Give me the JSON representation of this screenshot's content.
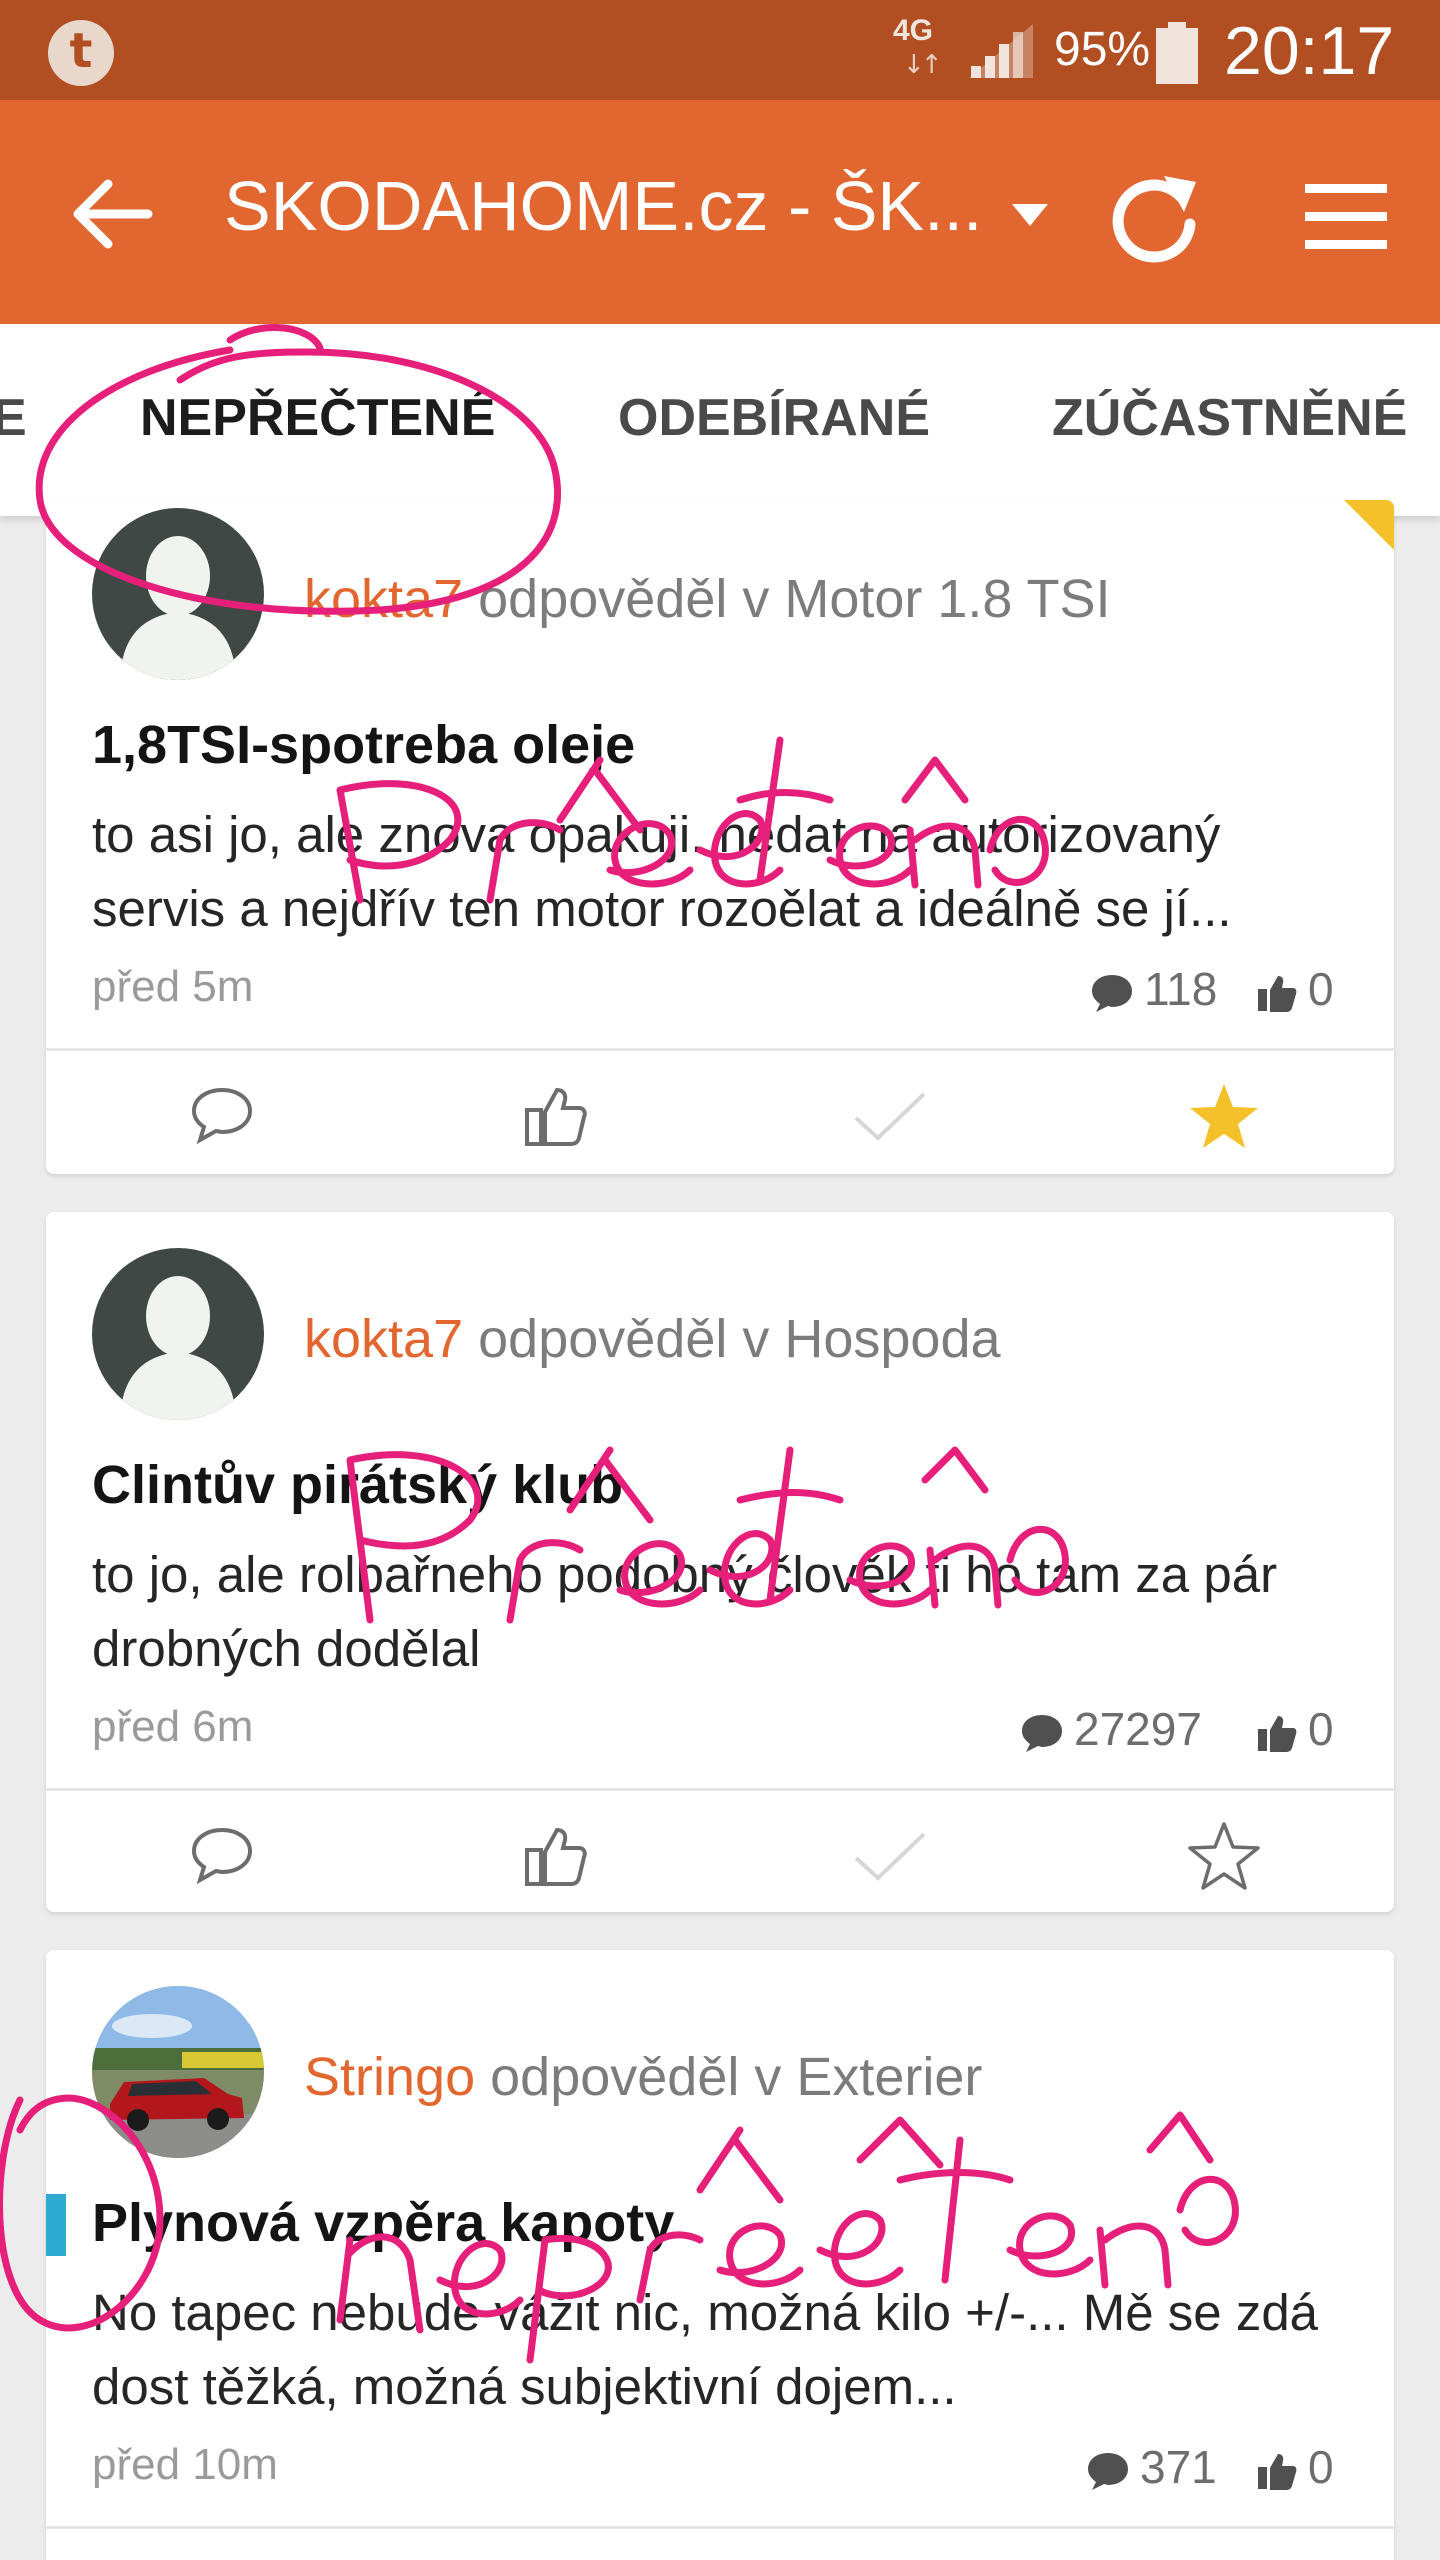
{
  "status_bar": {
    "network": "4G",
    "network_arrows": "↓↑",
    "battery_percent": "95%",
    "time": "20:17",
    "app_badge": "t"
  },
  "app_bar": {
    "title": "SKODAHOME.cz - ŠK...",
    "icons": [
      "back-arrow-icon",
      "dropdown-triangle-icon",
      "refresh-icon",
      "hamburger-menu-icon"
    ]
  },
  "tabs": {
    "items": [
      {
        "label": "E"
      },
      {
        "label": "NEPŘEČTENÉ"
      },
      {
        "label": "ODEBÍRANÉ"
      },
      {
        "label": "ZÚČASTNĚNÉ"
      }
    ],
    "active_index": 1
  },
  "feed": [
    {
      "author": "kokta7",
      "action": "odpověděl v Motor 1.8 TSI",
      "title": "1,8TSI-spotreba oleje",
      "body": "to asi jo, ale znova opakuji. nedat na autorizovaný servis a nejdřív ten motor rozoělat a ideálně se jí...",
      "time": "před 5m",
      "comments": "118",
      "likes": "0",
      "starred": true,
      "unread": false
    },
    {
      "author": "kokta7",
      "action": "odpověděl v Hospoda",
      "title": "Clintův pirátský klub",
      "body": "to jo, ale rolbařneho podobný člověk ti ho tam za pár drobných dodělal",
      "time": "před 6m",
      "comments": "27297",
      "likes": "0",
      "starred": false,
      "unread": false
    },
    {
      "author": "Stringo",
      "action": "odpověděl v Exterier",
      "title": "Plynová vzpěra kapoty",
      "body": "No tapec nebude vážit nic, možná kilo +/-... Mě se zdá dost těžká, možná subjektivní dojem...",
      "time": "před 10m",
      "comments": "371",
      "likes": "0",
      "starred": false,
      "unread": true
    }
  ],
  "colors": {
    "status_bar": "#b14f23",
    "app_bar": "#e26630",
    "accent_blue": "#2ea9cf",
    "author": "#e26630",
    "star": "#f5c12a",
    "annotation": "#e6207a"
  },
  "annotations": [
    "Přečteno",
    "Přečteno",
    "nepřečteno"
  ]
}
